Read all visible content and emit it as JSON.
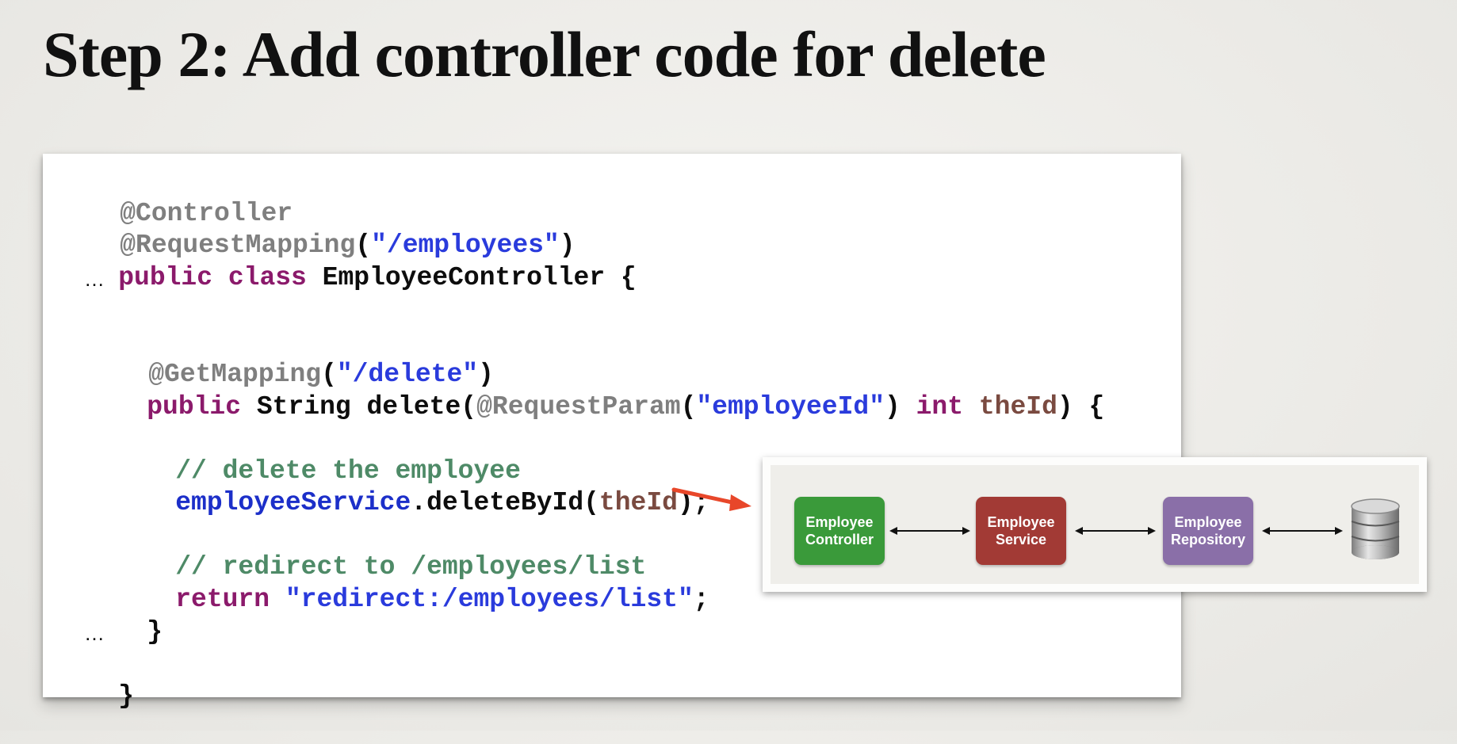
{
  "slide": {
    "title": "Step 2: Add controller code for delete"
  },
  "code": {
    "l1": "@Controller",
    "l2_ann": "@RequestMapping",
    "l2_open": "(",
    "l2_str": "\"/employees\"",
    "l2_close": ")",
    "l3_kw": "public class",
    "l3_id": " EmployeeController {",
    "l4": "…",
    "l6_ann": "@GetMapping",
    "l6_open": "(",
    "l6_str": "\"/delete\"",
    "l6_close": ")",
    "l7_kw": "public",
    "l7_id": " String delete(",
    "l7_ann": "@RequestParam",
    "l7_open": "(",
    "l7_str": "\"employeeId\"",
    "l7_mid": ") ",
    "l7_kw2": "int",
    "l7_sp": " ",
    "l7_var": "theId",
    "l7_end": ") {",
    "l9_cmt": "// delete the employee",
    "l10_fld": "employeeService",
    "l10_id": ".deleteById(",
    "l10_var": "theId",
    "l10_end": ");",
    "l12_cmt": "// redirect to /employees/list",
    "l13_kw": "return",
    "l13_sp": " ",
    "l13_str": "\"redirect:/employees/list\"",
    "l13_end": ";",
    "l14": "}",
    "l15": "…",
    "l16": "}"
  },
  "diagram": {
    "controller": {
      "line1": "Employee",
      "line2": "Controller",
      "color": "#3a9a3a"
    },
    "service": {
      "line1": "Employee",
      "line2": "Service",
      "color": "#a23a35"
    },
    "repository": {
      "line1": "Employee",
      "line2": "Repository",
      "color": "#8a6fa8"
    },
    "database_icon": "database-icon",
    "pointer_color": "#e8472a"
  }
}
